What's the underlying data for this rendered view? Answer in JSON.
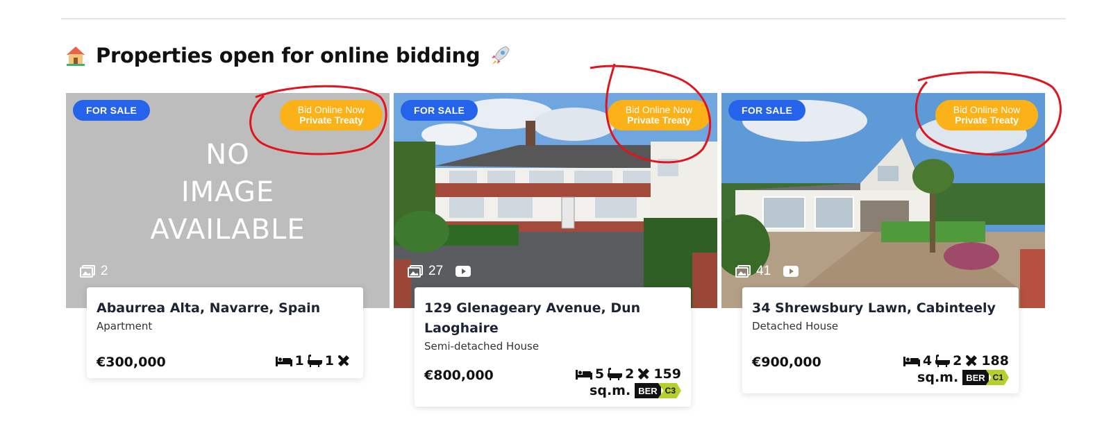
{
  "section": {
    "title": "Properties open for online bidding",
    "icons": [
      "house-icon",
      "rocket-icon"
    ]
  },
  "colors": {
    "sale_badge": "#2563eb",
    "bid_badge": "#fbb118",
    "annotation": "#e0141e",
    "ber_rating": "#b5cf2d"
  },
  "listings": [
    {
      "status": "FOR SALE",
      "bid_line1": "Bid Online Now",
      "bid_line2": "Private Treaty",
      "no_image": [
        "NO",
        "IMAGE",
        "AVAILABLE"
      ],
      "photo_count": "2",
      "address": "Abaurrea Alta, Navarre, Spain",
      "type": "Apartment",
      "price": "€300,000",
      "beds": "1",
      "baths": "1",
      "area": ""
    },
    {
      "status": "FOR SALE",
      "bid_line1": "Bid Online Now",
      "bid_line2": "Private Treaty",
      "photo_count": "27",
      "address": "129 Glenageary Avenue, Dun Laoghaire",
      "type": "Semi-detached House",
      "price": "€800,000",
      "beds": "5",
      "baths": "2",
      "area": "159",
      "area_unit": "sq.m.",
      "ber_label": "BER",
      "ber_rating": "C3"
    },
    {
      "status": "FOR SALE",
      "bid_line1": "Bid Online Now",
      "bid_line2": "Private Treaty",
      "photo_count": "41",
      "address": "34 Shrewsbury Lawn, Cabinteely",
      "type": "Detached House",
      "price": "€900,000",
      "beds": "4",
      "baths": "2",
      "area": "188",
      "area_unit": "sq.m.",
      "ber_label": "BER",
      "ber_rating": "C1"
    }
  ]
}
